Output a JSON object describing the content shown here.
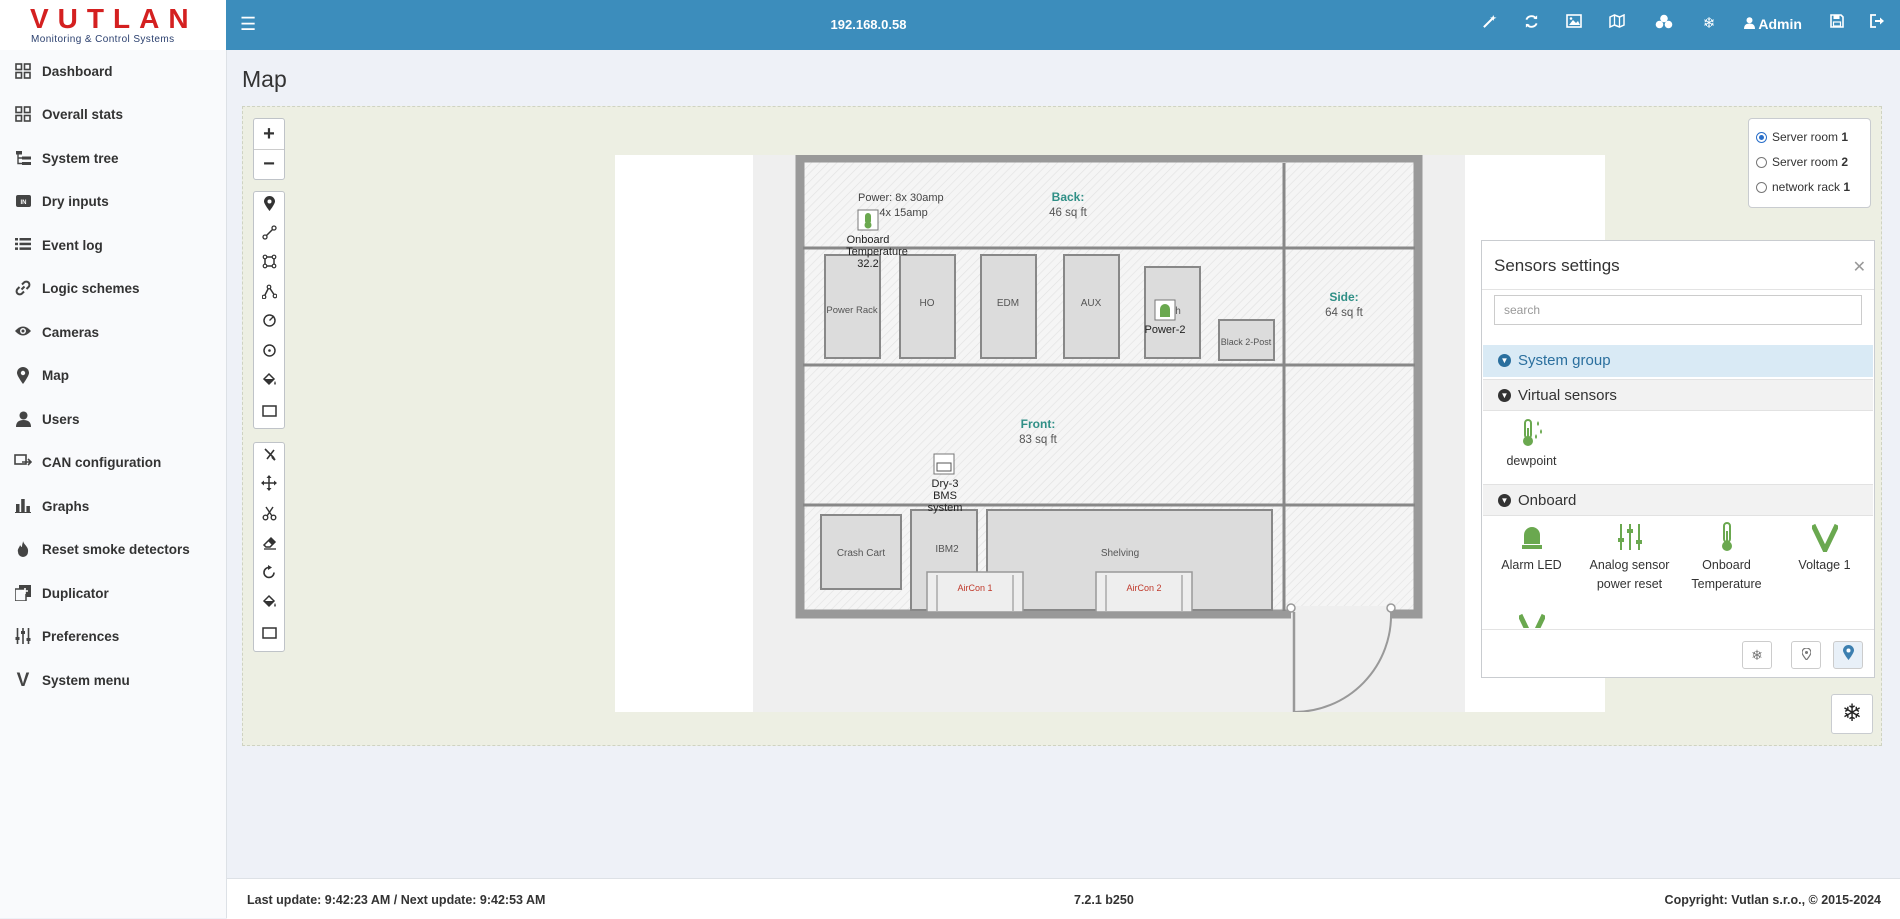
{
  "app": {
    "logo": "VUTLAN",
    "logo_subtitle": "Monitoring & Control Systems",
    "host": "192.168.0.58"
  },
  "toolbar": {
    "icons": [
      "magic-wand-icon",
      "refresh-icon",
      "image-icon",
      "map-icon",
      "cluster-icon",
      "snowflake-icon",
      "user-icon",
      "save-icon",
      "logout-icon"
    ],
    "user_label": "Admin"
  },
  "sidebar": {
    "items": [
      {
        "label": "Dashboard",
        "icon": "grid-icon"
      },
      {
        "label": "Overall stats",
        "icon": "grid-icon"
      },
      {
        "label": "System tree",
        "icon": "tree-icon"
      },
      {
        "label": "Dry inputs",
        "icon": "dry-input-icon"
      },
      {
        "label": "Event log",
        "icon": "list-icon"
      },
      {
        "label": "Logic schemes",
        "icon": "link-icon"
      },
      {
        "label": "Cameras",
        "icon": "eye-icon"
      },
      {
        "label": "Map",
        "icon": "map-marker-icon"
      },
      {
        "label": "Users",
        "icon": "users-icon"
      },
      {
        "label": "CAN configuration",
        "icon": "can-icon"
      },
      {
        "label": "Graphs",
        "icon": "bar-chart-icon"
      },
      {
        "label": "Reset smoke detectors",
        "icon": "fire-icon"
      },
      {
        "label": "Duplicator",
        "icon": "duplicate-icon"
      },
      {
        "label": "Preferences",
        "icon": "sliders-icon"
      },
      {
        "label": "System menu",
        "icon": "v-icon"
      }
    ]
  },
  "page": {
    "title": "Map"
  },
  "map_tools": {
    "zoom_in": "+",
    "zoom_out": "−",
    "draw": [
      "marker-icon",
      "polyline-icon",
      "polygon-icon",
      "path-icon",
      "circle-marker-icon",
      "circle-icon",
      "fill-icon",
      "rectangle-icon"
    ],
    "edit": [
      "cut-icon",
      "move-icon",
      "scissors-icon",
      "eraser-icon",
      "rotate-icon",
      "fill-icon",
      "rectangle-icon"
    ]
  },
  "floorplan": {
    "power_line1": "Power: 8x 30amp",
    "power_line2": "ver: 4x 15amp",
    "back_label": "Back:",
    "back_area": "46 sq ft",
    "side_label": "Side:",
    "side_area": "64 sq ft",
    "front_label": "Front:",
    "front_area": "83 sq ft",
    "racks": [
      "Power Rack",
      "HO",
      "EDM",
      "AUX",
      "h"
    ],
    "black_post": "Black 2-Post",
    "crash_cart": "Crash Cart",
    "ibm2": "IBM2",
    "shelving": "Shelving",
    "aircon1": "AirCon 1",
    "aircon2": "AirCon 2",
    "markers": {
      "onboard_temp": {
        "line1": "Onboard",
        "line2": "Temperature",
        "value": "32.2"
      },
      "power2": "Power-2",
      "dry3": {
        "line1": "Dry-3",
        "line2": "BMS",
        "line3": "system"
      }
    }
  },
  "rooms": [
    {
      "name": "Server room",
      "num": "1",
      "selected": true
    },
    {
      "name": "Server room",
      "num": "2",
      "selected": false
    },
    {
      "name": "network rack",
      "num": "1",
      "selected": false
    }
  ],
  "sensors_panel": {
    "title": "Sensors settings",
    "search_placeholder": "search",
    "groups": {
      "system": "System group",
      "virtual": "Virtual sensors",
      "onboard": "Onboard"
    },
    "virtual_sensors": [
      "dewpoint"
    ],
    "onboard_sensors": [
      {
        "line1": "Alarm LED",
        "line2": ""
      },
      {
        "line1": "Analog sensor",
        "line2": "power reset"
      },
      {
        "line1": "Onboard",
        "line2": "Temperature"
      },
      {
        "line1": "Voltage 1",
        "line2": ""
      }
    ],
    "accent": "#6aa84f"
  },
  "footer": {
    "last_update": "Last update: 9:42:23 AM / Next update: 9:42:53 AM",
    "version": "7.2.1 b250",
    "copyright": "Copyright: Vutlan s.r.o., © 2015-2024"
  }
}
